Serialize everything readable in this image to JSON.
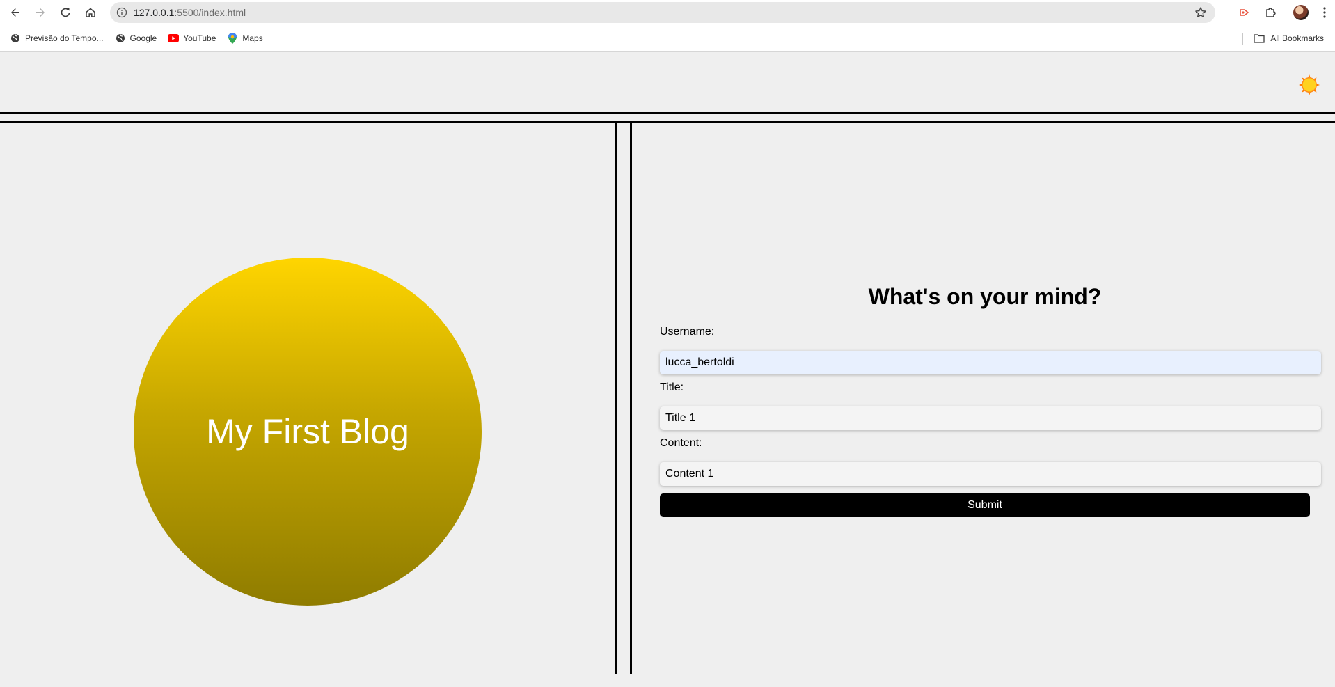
{
  "browser": {
    "url_host": "127.0.0.1",
    "url_path": ":5500/index.html",
    "bookmarks": [
      {
        "label": "Previsão do Tempo...",
        "icon": "globe-icon"
      },
      {
        "label": "Google",
        "icon": "globe-icon"
      },
      {
        "label": "YouTube",
        "icon": "youtube-icon"
      },
      {
        "label": "Maps",
        "icon": "maps-pin-icon"
      }
    ],
    "all_bookmarks_label": "All Bookmarks"
  },
  "header": {
    "theme_toggle_icon": "sun-icon"
  },
  "hero": {
    "title": "My First Blog",
    "gradient": [
      "#ffd500",
      "#8f7c00"
    ]
  },
  "form": {
    "heading": "What's on your mind?",
    "username_label": "Username:",
    "username_value": "lucca_bertoldi",
    "title_label": "Title:",
    "title_value": "Title 1",
    "content_label": "Content:",
    "content_value": "Content 1",
    "submit_label": "Submit"
  },
  "colors": {
    "page_bg": "#efefef",
    "divider": "#000000",
    "submit_bg": "#000000",
    "autofill_bg": "#e8f0fe"
  }
}
